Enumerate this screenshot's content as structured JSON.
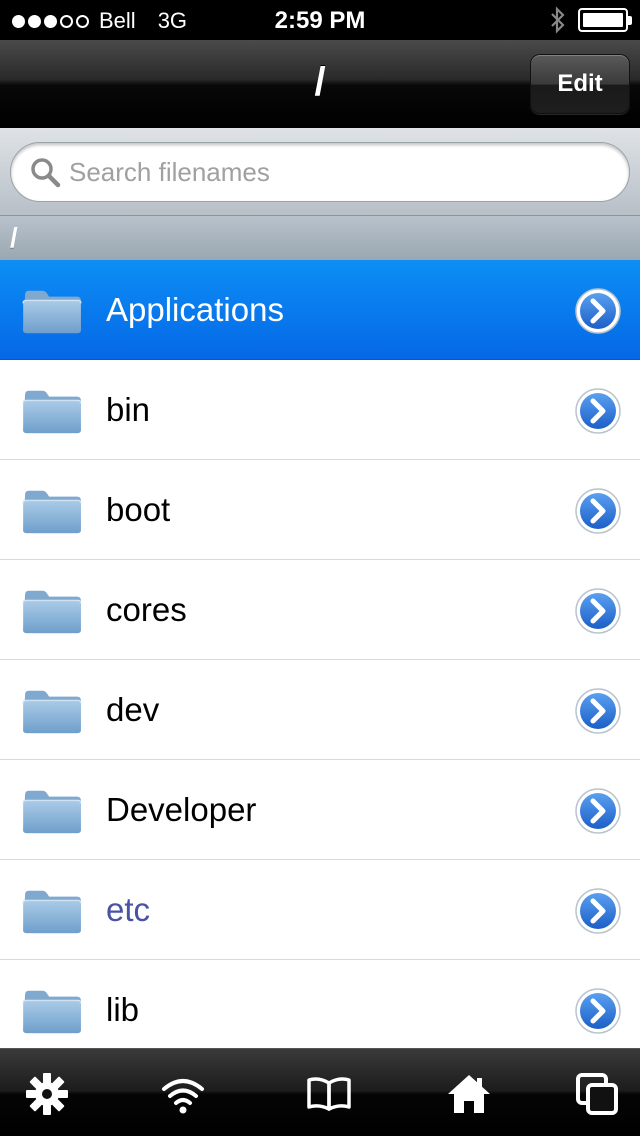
{
  "status": {
    "carrier": "Bell",
    "network": "3G",
    "time": "2:59 PM",
    "signal_bars": 3,
    "signal_total": 5,
    "battery_level": 1.0
  },
  "nav": {
    "title": "/",
    "edit_label": "Edit"
  },
  "search": {
    "placeholder": "Search filenames",
    "value": ""
  },
  "path": "/",
  "files": [
    {
      "name": "Applications",
      "type": "folder",
      "selected": true
    },
    {
      "name": "bin",
      "type": "folder"
    },
    {
      "name": "boot",
      "type": "folder"
    },
    {
      "name": "cores",
      "type": "folder"
    },
    {
      "name": "dev",
      "type": "folder"
    },
    {
      "name": "Developer",
      "type": "folder"
    },
    {
      "name": "etc",
      "type": "folder",
      "visited": true
    },
    {
      "name": "lib",
      "type": "folder"
    }
  ],
  "tabs": [
    {
      "icon": "gear-icon"
    },
    {
      "icon": "wifi-icon"
    },
    {
      "icon": "book-icon"
    },
    {
      "icon": "home-icon"
    },
    {
      "icon": "windows-icon"
    }
  ],
  "colors": {
    "selection": "#0a7ded",
    "visited_link": "#4a52a3",
    "disclosure": "#2f79dc"
  }
}
